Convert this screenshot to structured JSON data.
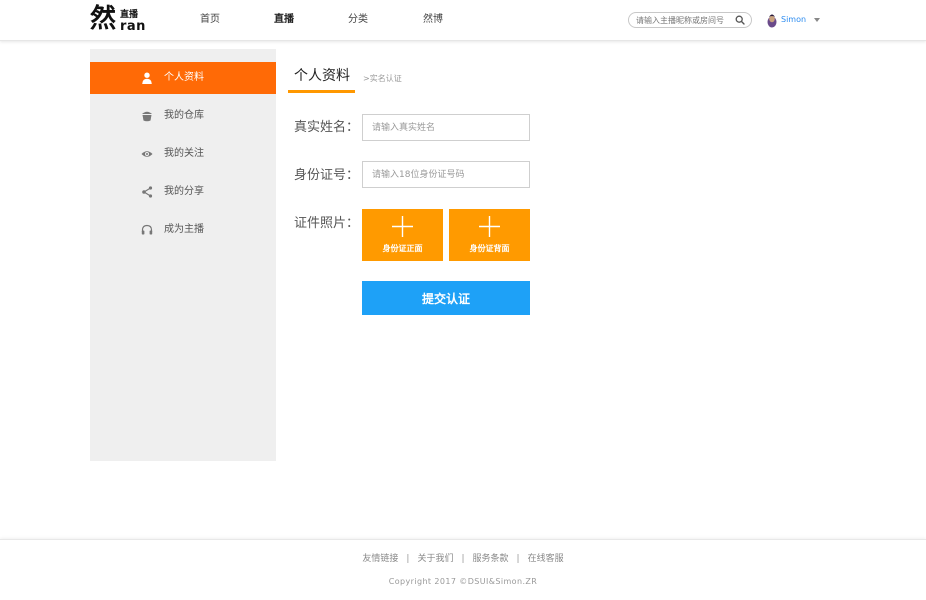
{
  "header": {
    "logo_main": "然",
    "logo_small": "直播",
    "logo_en": "ran",
    "nav": [
      {
        "label": "首页",
        "active": false
      },
      {
        "label": "直播",
        "active": true
      },
      {
        "label": "分类",
        "active": false
      },
      {
        "label": "然博",
        "active": false
      }
    ],
    "search_placeholder": "请输入主播昵称或房间号",
    "search_icon": "search-icon",
    "username": "Simon",
    "user_menu_icon": "caret-down-icon"
  },
  "sidebar": {
    "items": [
      {
        "label": "个人资料",
        "icon": "person-icon",
        "active": true
      },
      {
        "label": "我的仓库",
        "icon": "warehouse-icon",
        "active": false
      },
      {
        "label": "我的关注",
        "icon": "eye-icon",
        "active": false
      },
      {
        "label": "我的分享",
        "icon": "share-icon",
        "active": false
      },
      {
        "label": "成为主播",
        "icon": "headphones-icon",
        "active": false
      }
    ]
  },
  "main": {
    "tab_title": "个人资料",
    "tab_sub": ">实名认证",
    "fields": [
      {
        "label": "真实姓名：",
        "placeholder": "请输入真实姓名"
      },
      {
        "label": "身份证号：",
        "placeholder": "请输入18位身份证号码"
      }
    ],
    "photo_label": "证件照片：",
    "uploads": [
      {
        "label": "身份证正面",
        "icon": "plus-icon"
      },
      {
        "label": "身份证背面",
        "icon": "plus-icon"
      }
    ],
    "submit_label": "提交认证"
  },
  "footer": {
    "links": [
      "友情链接",
      "关于我们",
      "服务条款",
      "在线客服"
    ],
    "separator": "|",
    "copyright": "Copyright 2017 ©DSUI&Simon.ZR"
  },
  "colors": {
    "accent_orange": "#ff6a06",
    "upload_orange": "#ff9a00",
    "submit_blue": "#1ea1f7",
    "username_blue": "#2d8cf0"
  }
}
